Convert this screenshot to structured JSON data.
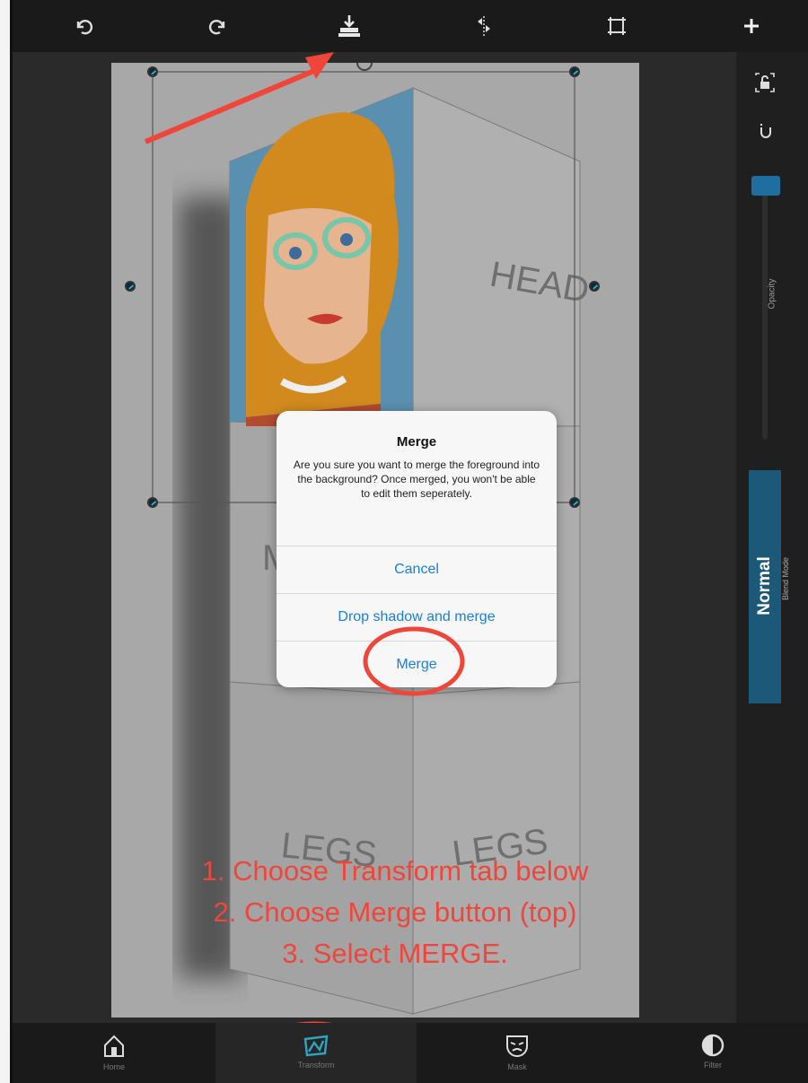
{
  "toolbar": {
    "icons": [
      "undo-icon",
      "redo-icon",
      "merge-layer-icon",
      "flip-icon",
      "crop-icon",
      "add-icon"
    ]
  },
  "canvas": {
    "panel_labels": {
      "head": "HEAD",
      "middle": "M",
      "legs_left": "LEGS",
      "legs_right": "LEGS"
    }
  },
  "dialog": {
    "title": "Merge",
    "message": "Are you sure you want to merge the foreground into the background? Once merged, you won't be able to edit them seperately.",
    "cancel_label": "Cancel",
    "drop_shadow_label": "Drop shadow and merge",
    "merge_label": "Merge"
  },
  "right_panel": {
    "opacity_label": "Opacity",
    "opacity_value": 0.97,
    "blend_mode_value": "Normal",
    "blend_mode_label": "Blend Mode"
  },
  "instructions": {
    "line1": "1. Choose Transform tab below",
    "line2": "2. Choose Merge button (top)",
    "line3": "3. Select MERGE."
  },
  "bottom_tabs": [
    {
      "label": "Home",
      "icon": "home-icon"
    },
    {
      "label": "Transform",
      "icon": "transform-icon"
    },
    {
      "label": "Mask",
      "icon": "mask-icon"
    },
    {
      "label": "Filter",
      "icon": "contrast-icon"
    }
  ],
  "colors": {
    "accent_blue": "#1a7ee8",
    "annotation_red": "#f0463a",
    "blend_button": "#1c5978",
    "transform_tab": "#2fa5c2"
  }
}
